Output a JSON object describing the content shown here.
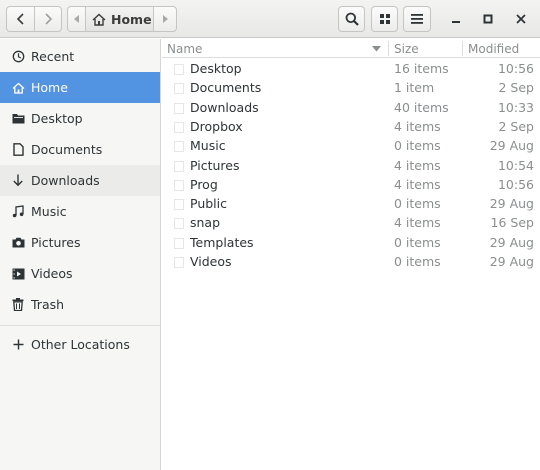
{
  "header": {
    "path_label": "Home"
  },
  "sidebar": {
    "items": [
      {
        "label": "Recent",
        "icon": "clock-icon"
      },
      {
        "label": "Home",
        "icon": "home-icon",
        "active": true
      },
      {
        "label": "Desktop",
        "icon": "folder-icon"
      },
      {
        "label": "Documents",
        "icon": "document-icon"
      },
      {
        "label": "Downloads",
        "icon": "download-icon"
      },
      {
        "label": "Music",
        "icon": "music-icon"
      },
      {
        "label": "Pictures",
        "icon": "camera-icon"
      },
      {
        "label": "Videos",
        "icon": "video-icon"
      },
      {
        "label": "Trash",
        "icon": "trash-icon"
      }
    ],
    "other_locations": "Other Locations"
  },
  "columns": {
    "name": "Name",
    "size": "Size",
    "modified": "Modified"
  },
  "files": [
    {
      "name": "Desktop",
      "size": "16 items",
      "modified": "10:56"
    },
    {
      "name": "Documents",
      "size": "1 item",
      "modified": "2 Sep"
    },
    {
      "name": "Downloads",
      "size": "40 items",
      "modified": "10:33"
    },
    {
      "name": "Dropbox",
      "size": "4 items",
      "modified": "2 Sep"
    },
    {
      "name": "Music",
      "size": "0 items",
      "modified": "29 Aug"
    },
    {
      "name": "Pictures",
      "size": "4 items",
      "modified": "10:54"
    },
    {
      "name": "Prog",
      "size": "4 items",
      "modified": "10:56"
    },
    {
      "name": "Public",
      "size": "0 items",
      "modified": "29 Aug"
    },
    {
      "name": "snap",
      "size": "4 items",
      "modified": "16 Sep"
    },
    {
      "name": "Templates",
      "size": "0 items",
      "modified": "29 Aug"
    },
    {
      "name": "Videos",
      "size": "0 items",
      "modified": "29 Aug"
    }
  ],
  "colors": {
    "accent": "#5294e2"
  }
}
